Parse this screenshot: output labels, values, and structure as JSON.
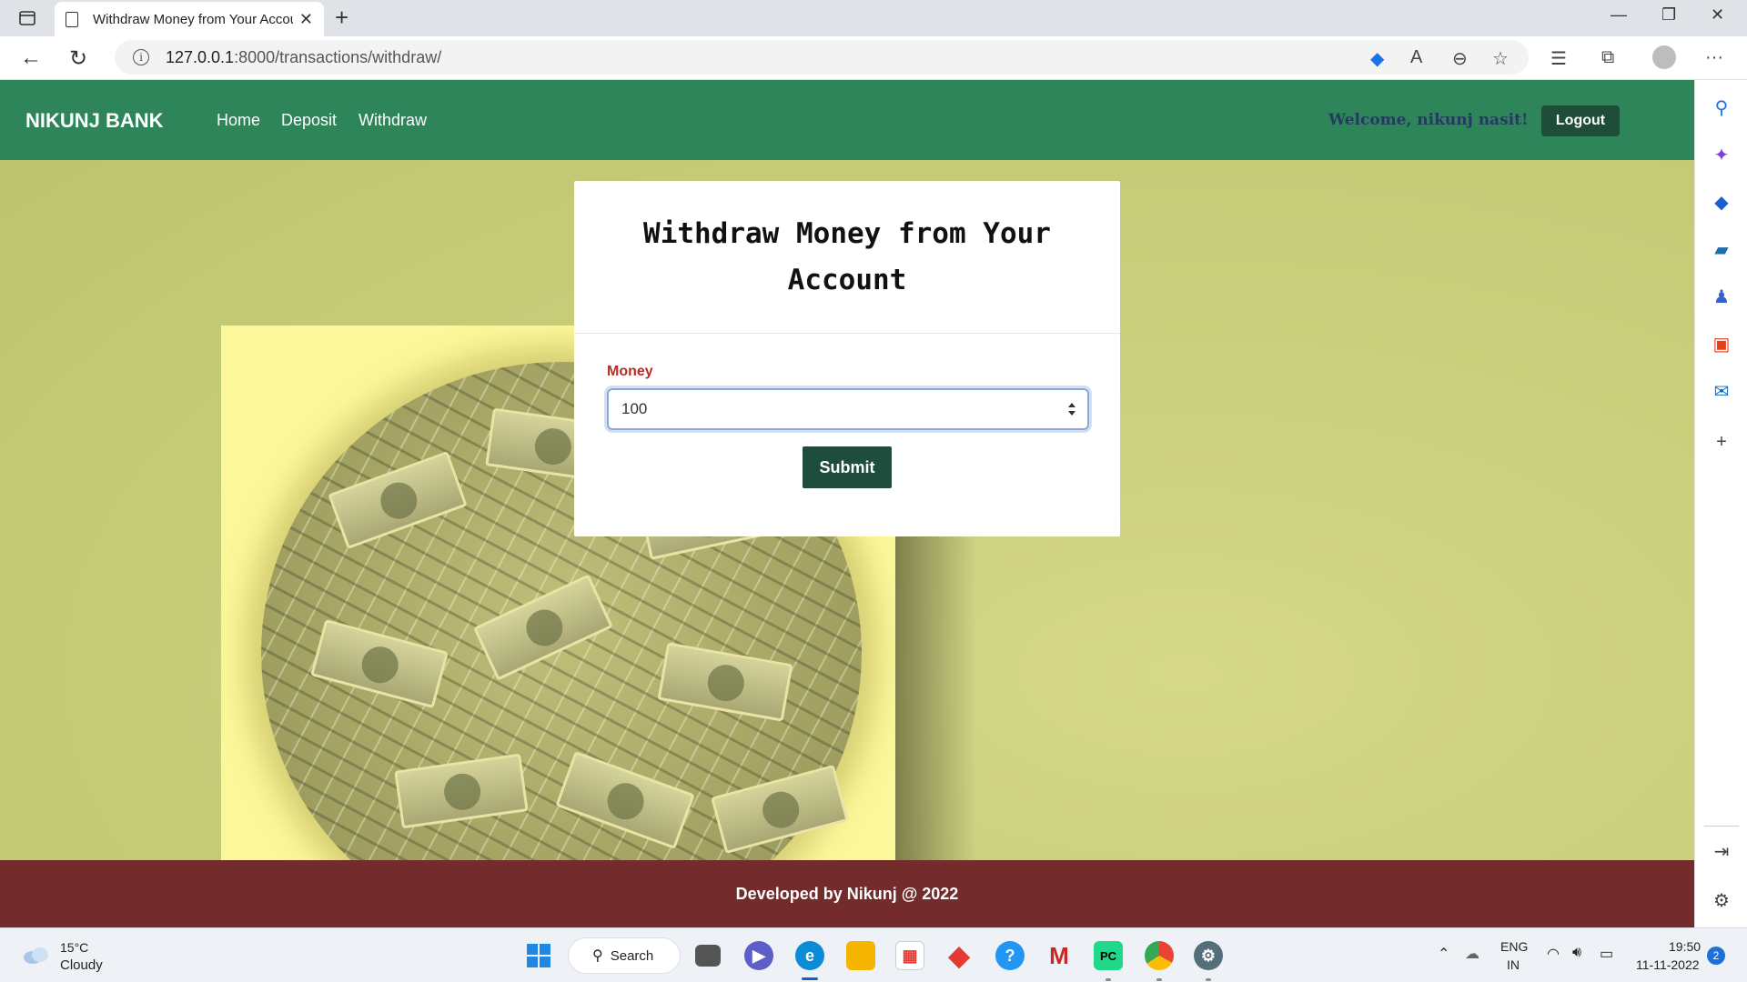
{
  "browser": {
    "tab_title": "Withdraw Money from Your Account",
    "url_host": "127.0.0.1",
    "url_path": ":8000/transactions/withdraw/",
    "sidebar_icons": [
      "search-icon",
      "copilot-icon",
      "shopping-icon",
      "tools-icon",
      "games-icon",
      "office-icon",
      "outlook-icon",
      "add-icon"
    ]
  },
  "navbar": {
    "brand": "NIKUNJ BANK",
    "links": [
      "Home",
      "Deposit",
      "Withdraw"
    ],
    "welcome": "Welcome, nikunj nasit!",
    "logout": "Logout"
  },
  "form": {
    "title": "Withdraw Money from Your Account",
    "label": "Money",
    "value": "100",
    "submit": "Submit"
  },
  "footer": {
    "text": "Developed by Nikunj @ 2022"
  },
  "taskbar": {
    "temp": "15°C",
    "condition": "Cloudy",
    "search": "Search",
    "lang1": "ENG",
    "lang2": "IN",
    "time": "19:50",
    "date": "11-11-2022",
    "notifications": "2"
  },
  "colors": {
    "navbar": "#2e855a",
    "footer": "#732b2c",
    "button": "#1f4d3c",
    "page_bg": "#c5cb77"
  }
}
